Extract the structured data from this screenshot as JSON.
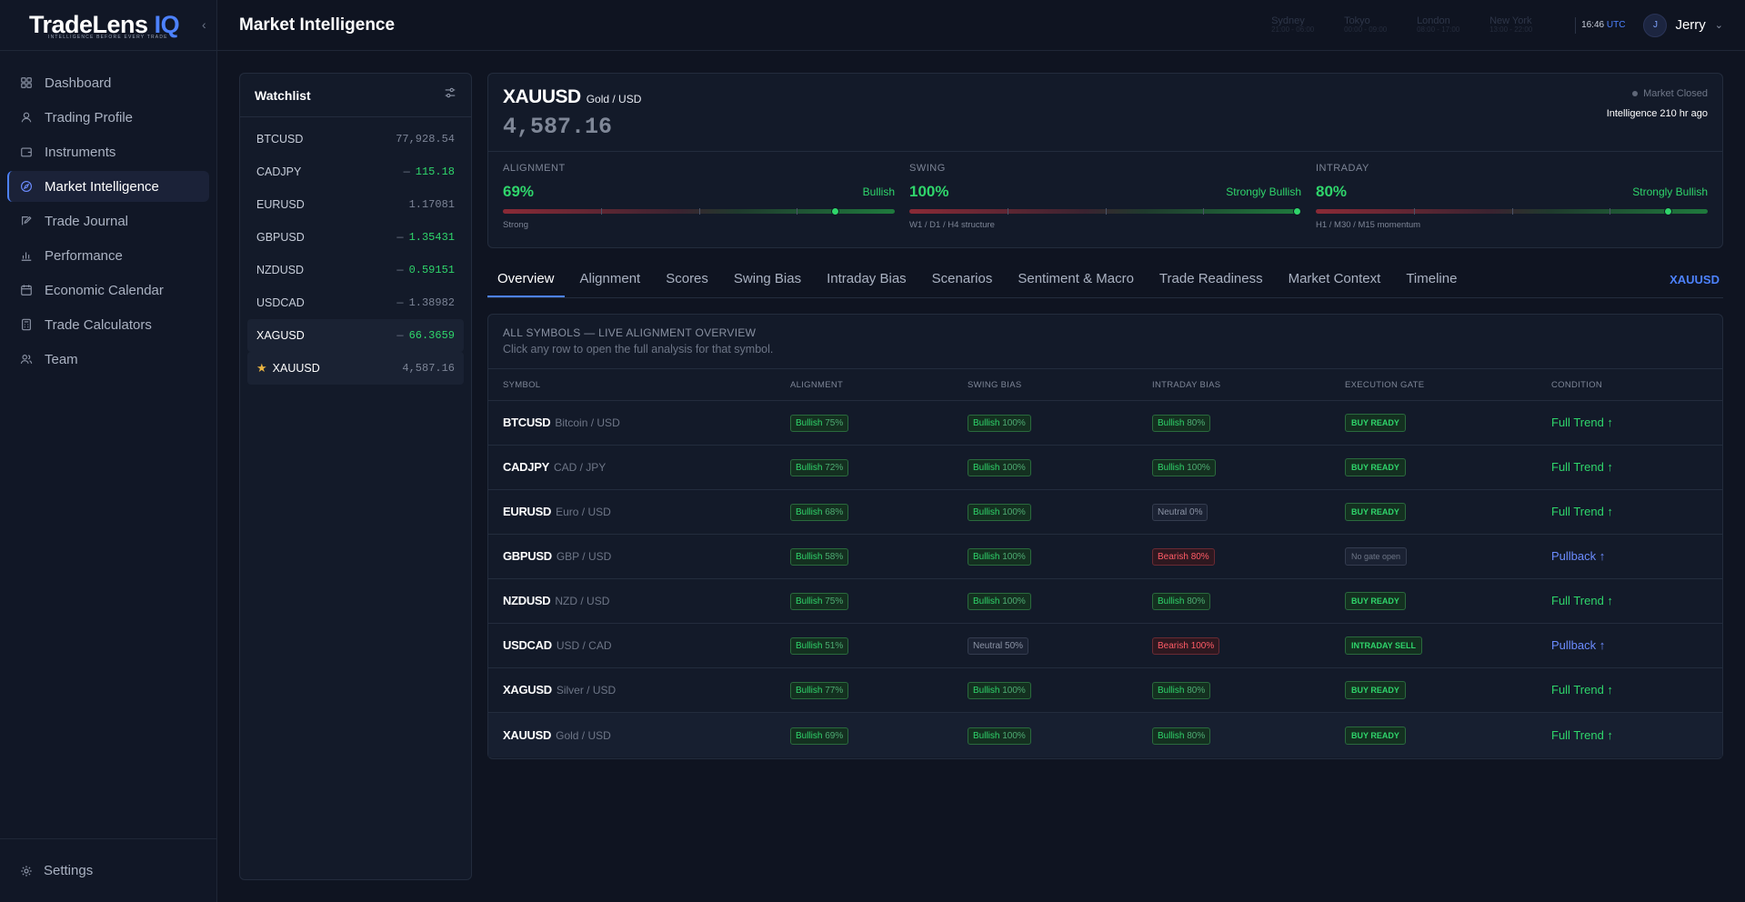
{
  "brand": {
    "name_main": "TradeLens",
    "name_accent": "IQ",
    "tagline": "INTELLIGENCE BEFORE EVERY TRADE"
  },
  "sidebar": {
    "items": [
      {
        "label": "Dashboard",
        "icon": "dashboard-icon"
      },
      {
        "label": "Trading Profile",
        "icon": "user-icon"
      },
      {
        "label": "Instruments",
        "icon": "wallet-icon"
      },
      {
        "label": "Market Intelligence",
        "icon": "compass-icon",
        "active": true
      },
      {
        "label": "Trade Journal",
        "icon": "edit-icon"
      },
      {
        "label": "Performance",
        "icon": "bar-chart-icon"
      },
      {
        "label": "Economic Calendar",
        "icon": "calendar-icon"
      },
      {
        "label": "Trade Calculators",
        "icon": "calculator-icon"
      },
      {
        "label": "Team",
        "icon": "team-icon"
      }
    ],
    "settings_label": "Settings"
  },
  "header": {
    "title": "Market Intelligence",
    "sessions": [
      {
        "name": "Sydney",
        "time": "21:00 - 06:00"
      },
      {
        "name": "Tokyo",
        "time": "00:00 - 09:00"
      },
      {
        "name": "London",
        "time": "08:00 - 17:00"
      },
      {
        "name": "New York",
        "time": "13:00 - 22:00"
      }
    ],
    "clock": "16:46",
    "clock_tz": "UTC",
    "user_initial": "J",
    "user_name": "Jerry"
  },
  "watchlist": {
    "title": "Watchlist",
    "items": [
      {
        "symbol": "BTCUSD",
        "price": "77,928.54",
        "dash": "",
        "up": false
      },
      {
        "symbol": "CADJPY",
        "price": "115.18",
        "dash": "—",
        "up": true
      },
      {
        "symbol": "EURUSD",
        "price": "1.17081",
        "dash": "",
        "up": false
      },
      {
        "symbol": "GBPUSD",
        "price": "1.35431",
        "dash": "—",
        "up": true
      },
      {
        "symbol": "NZDUSD",
        "price": "0.59151",
        "dash": "—",
        "up": true
      },
      {
        "symbol": "USDCAD",
        "price": "1.38982",
        "dash": "—",
        "up": false
      },
      {
        "symbol": "XAGUSD",
        "price": "66.3659",
        "dash": "—",
        "up": true
      },
      {
        "symbol": "XAUUSD",
        "price": "4,587.16",
        "dash": "",
        "up": false,
        "starred": true
      }
    ]
  },
  "detail": {
    "symbol": "XAUUSD",
    "name": "Gold / USD",
    "price": "4,587.16",
    "market_status": "Market Closed",
    "intel_age": "Intelligence 210 hr ago",
    "metrics": [
      {
        "label": "ALIGNMENT",
        "value": "69%",
        "bias": "Bullish",
        "sub": "Strong",
        "level": 0.85
      },
      {
        "label": "SWING",
        "value": "100%",
        "bias": "Strongly Bullish",
        "sub": "W1 / D1 / H4 structure",
        "level": 0.99
      },
      {
        "label": "INTRADAY",
        "value": "80%",
        "bias": "Strongly Bullish",
        "sub": "H1 / M30 / M15 momentum",
        "level": 0.9
      }
    ]
  },
  "tabs": [
    "Overview",
    "Alignment",
    "Scores",
    "Swing Bias",
    "Intraday Bias",
    "Scenarios",
    "Sentiment & Macro",
    "Trade Readiness",
    "Market Context",
    "Timeline"
  ],
  "tab_symbol": "XAUUSD",
  "table": {
    "title": "ALL SYMBOLS — LIVE ALIGNMENT OVERVIEW",
    "subtitle": "Click any row to open the full analysis for that symbol.",
    "columns": [
      "SYMBOL",
      "ALIGNMENT",
      "SWING BIAS",
      "INTRADAY BIAS",
      "EXECUTION GATE",
      "CONDITION"
    ],
    "rows": [
      {
        "symbol": "BTCUSD",
        "name": "Bitcoin / USD",
        "align": [
          "Bullish",
          "75%"
        ],
        "swing": [
          "Bullish",
          "100%"
        ],
        "intra": [
          "Bullish",
          "80%"
        ],
        "gate": "BUY READY",
        "cond": "Full Trend ↑"
      },
      {
        "symbol": "CADJPY",
        "name": "CAD / JPY",
        "align": [
          "Bullish",
          "72%"
        ],
        "swing": [
          "Bullish",
          "100%"
        ],
        "intra": [
          "Bullish",
          "100%"
        ],
        "gate": "BUY READY",
        "cond": "Full Trend ↑"
      },
      {
        "symbol": "EURUSD",
        "name": "Euro / USD",
        "align": [
          "Bullish",
          "68%"
        ],
        "swing": [
          "Bullish",
          "100%"
        ],
        "intra": [
          "Neutral",
          "0%"
        ],
        "gate": "BUY READY",
        "cond": "Full Trend ↑"
      },
      {
        "symbol": "GBPUSD",
        "name": "GBP / USD",
        "align": [
          "Bullish",
          "58%"
        ],
        "swing": [
          "Bullish",
          "100%"
        ],
        "intra": [
          "Bearish",
          "80%"
        ],
        "gate": "No gate open",
        "cond": "Pullback ↑"
      },
      {
        "symbol": "NZDUSD",
        "name": "NZD / USD",
        "align": [
          "Bullish",
          "75%"
        ],
        "swing": [
          "Bullish",
          "100%"
        ],
        "intra": [
          "Bullish",
          "80%"
        ],
        "gate": "BUY READY",
        "cond": "Full Trend ↑"
      },
      {
        "symbol": "USDCAD",
        "name": "USD / CAD",
        "align": [
          "Bullish",
          "51%"
        ],
        "swing": [
          "Neutral",
          "50%"
        ],
        "intra": [
          "Bearish",
          "100%"
        ],
        "gate": "INTRADAY SELL",
        "cond": "Pullback ↑"
      },
      {
        "symbol": "XAGUSD",
        "name": "Silver / USD",
        "align": [
          "Bullish",
          "77%"
        ],
        "swing": [
          "Bullish",
          "100%"
        ],
        "intra": [
          "Bullish",
          "80%"
        ],
        "gate": "BUY READY",
        "cond": "Full Trend ↑"
      },
      {
        "symbol": "XAUUSD",
        "name": "Gold / USD",
        "align": [
          "Bullish",
          "69%"
        ],
        "swing": [
          "Bullish",
          "100%"
        ],
        "intra": [
          "Bullish",
          "80%"
        ],
        "gate": "BUY READY",
        "cond": "Full Trend ↑"
      }
    ]
  }
}
